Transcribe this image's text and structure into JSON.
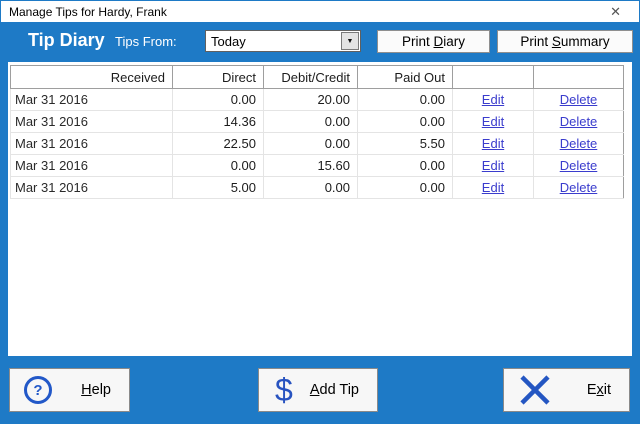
{
  "window": {
    "title": "Manage Tips for Hardy, Frank",
    "close_icon": "✕"
  },
  "header": {
    "title": "Tip Diary",
    "tips_from_label": "Tips From:",
    "combo_value": "Today",
    "combo_arrow": "▼",
    "print_diary": {
      "pre": "Print ",
      "key": "D",
      "post": "iary"
    },
    "print_summary": {
      "pre": "Print ",
      "key": "S",
      "post": "ummary"
    }
  },
  "table": {
    "columns": [
      "Received",
      "Direct",
      "Debit/Credit",
      "Paid Out"
    ],
    "edit_label": "Edit",
    "delete_label": "Delete",
    "rows": [
      {
        "received": "Mar 31 2016",
        "direct": "0.00",
        "debit_credit": "20.00",
        "paid_out": "0.00"
      },
      {
        "received": "Mar 31 2016",
        "direct": "14.36",
        "debit_credit": "0.00",
        "paid_out": "0.00"
      },
      {
        "received": "Mar 31 2016",
        "direct": "22.50",
        "debit_credit": "0.00",
        "paid_out": "5.50"
      },
      {
        "received": "Mar 31 2016",
        "direct": "0.00",
        "debit_credit": "15.60",
        "paid_out": "0.00"
      },
      {
        "received": "Mar 31 2016",
        "direct": "5.00",
        "debit_credit": "0.00",
        "paid_out": "0.00"
      }
    ]
  },
  "footer": {
    "help": {
      "pre": "",
      "key": "H",
      "post": "elp"
    },
    "add_tip": {
      "pre": "",
      "key": "A",
      "post": "dd Tip"
    },
    "exit": {
      "pre": "E",
      "key": "x",
      "post": "it"
    },
    "help_glyph": "?",
    "dollar_glyph": "$"
  },
  "colors": {
    "frame_blue": "#1e7ac6",
    "link_blue": "#3a3ccd",
    "icon_blue": "#2258c8"
  }
}
